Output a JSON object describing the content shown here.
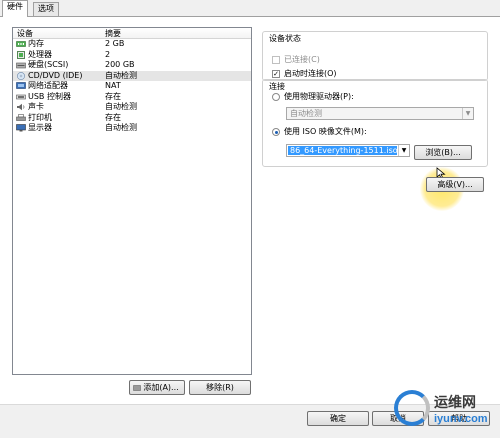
{
  "tabs": [
    {
      "label": "硬件",
      "active": true
    },
    {
      "label": "选项",
      "active": false
    }
  ],
  "device_list": {
    "headers": {
      "device": "设备",
      "summary": "摘要"
    },
    "rows": [
      {
        "icon": "memory-icon",
        "name": "内存",
        "summary": "2 GB"
      },
      {
        "icon": "cpu-icon",
        "name": "处理器",
        "summary": "2"
      },
      {
        "icon": "hard-disk-icon",
        "name": "硬盘(SCSI)",
        "summary": "200 GB"
      },
      {
        "icon": "cd-dvd-icon",
        "name": "CD/DVD (IDE)",
        "summary": "自动检测",
        "selected": true
      },
      {
        "icon": "network-adapter-icon",
        "name": "网络适配器",
        "summary": "NAT"
      },
      {
        "icon": "usb-controller-icon",
        "name": "USB 控制器",
        "summary": "存在"
      },
      {
        "icon": "sound-card-icon",
        "name": "声卡",
        "summary": "自动检测"
      },
      {
        "icon": "printer-icon",
        "name": "打印机",
        "summary": "存在"
      },
      {
        "icon": "display-icon",
        "name": "显示器",
        "summary": "自动检测"
      }
    ]
  },
  "buttons": {
    "add": "添加(A)...",
    "remove": "移除(R)",
    "ok": "确定",
    "cancel": "取消",
    "help": "帮助",
    "browse": "浏览(B)...",
    "advanced": "高级(V)..."
  },
  "device_status": {
    "title": "设备状态",
    "connected_label": "已连接(C)",
    "connected_checked": false,
    "connected_enabled": false,
    "connect_at_power_on_label": "启动时连接(O)",
    "connect_at_power_on_checked": true
  },
  "connection": {
    "title": "连接",
    "physical_drive_label": "使用物理驱动器(P):",
    "physical_drive_selected": false,
    "physical_drive_value": "自动检测",
    "iso_label": "使用 ISO 映像文件(M):",
    "iso_selected": true,
    "iso_value": "86_64-Everything-1511.iso"
  },
  "watermark": {
    "line1": "运维网",
    "line2": "iyunv.com"
  },
  "colors": {
    "selection": "#3399ff",
    "accent": "#2a7fd4"
  }
}
